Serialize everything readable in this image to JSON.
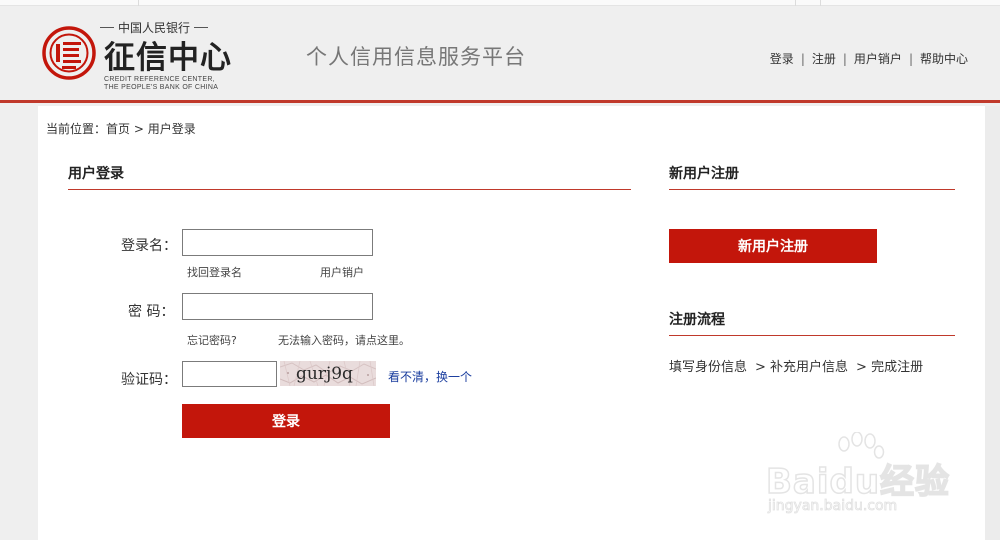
{
  "logo": {
    "top_line": "中国人民银行",
    "main_name": "征信中心",
    "english_line1": "CREDIT REFERENCE CENTER,",
    "english_line2": "THE PEOPLE'S BANK OF CHINA"
  },
  "header": {
    "platform_title": "个人信用信息服务平台",
    "nav": [
      "登录",
      "注册",
      "用户销户",
      "帮助中心"
    ]
  },
  "breadcrumb": {
    "prefix": "当前位置：",
    "home": "首页",
    "current": " > 用户登录"
  },
  "login": {
    "title": "用户登录",
    "username_label": "登录名：",
    "username_value": "",
    "recover_username": "找回登录名",
    "cancel_account": "用户销户",
    "password_label": "密 码：",
    "password_value": "",
    "forgot_password": "忘记密码?",
    "cannot_input_password": "无法输入密码，请点这里。",
    "captcha_label": "验证码：",
    "captcha_value": "",
    "captcha_text": "gurj9q",
    "refresh_captcha": "看不清，换一个",
    "submit": "登录"
  },
  "register": {
    "title": "新用户注册",
    "button": "新用户注册",
    "process_title": "注册流程",
    "steps": [
      "填写身份信息",
      "> 补充用户信息",
      "> 完成注册"
    ]
  },
  "watermark": {
    "brand": "Baidu经验",
    "url": "jingyan.baidu.com"
  },
  "colors": {
    "accent_red": "#c3160b",
    "line_red": "#c0392b",
    "link_blue": "#1a3d9e"
  }
}
